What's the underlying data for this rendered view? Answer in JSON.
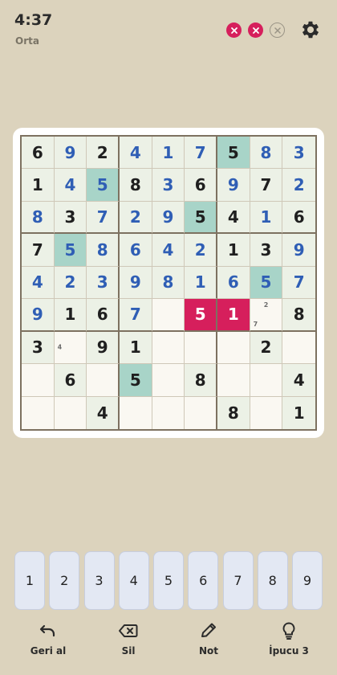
{
  "header": {
    "timer": "4:37",
    "difficulty": "Orta",
    "mistakes": [
      {
        "state": "on",
        "icon": "x-circle-icon"
      },
      {
        "state": "on",
        "icon": "x-circle-icon"
      },
      {
        "state": "off",
        "icon": "x-circle-icon"
      }
    ]
  },
  "colors": {
    "background": "#dcd3bd",
    "given_digit": "#1f1f1f",
    "user_digit": "#2f5eb5",
    "highlight": "#a8d4c8",
    "error": "#d61f5c",
    "filled_cell": "#ecf1e6"
  },
  "board": {
    "rows": [
      [
        {
          "v": "6",
          "t": "given"
        },
        {
          "v": "9",
          "t": "user"
        },
        {
          "v": "2",
          "t": "given"
        },
        {
          "v": "4",
          "t": "user"
        },
        {
          "v": "1",
          "t": "user"
        },
        {
          "v": "7",
          "t": "user"
        },
        {
          "v": "5",
          "t": "given",
          "h": true
        },
        {
          "v": "8",
          "t": "user"
        },
        {
          "v": "3",
          "t": "user"
        }
      ],
      [
        {
          "v": "1",
          "t": "given"
        },
        {
          "v": "4",
          "t": "user"
        },
        {
          "v": "5",
          "t": "user",
          "h": true
        },
        {
          "v": "8",
          "t": "given"
        },
        {
          "v": "3",
          "t": "user"
        },
        {
          "v": "6",
          "t": "given"
        },
        {
          "v": "9",
          "t": "user"
        },
        {
          "v": "7",
          "t": "given"
        },
        {
          "v": "2",
          "t": "user"
        }
      ],
      [
        {
          "v": "8",
          "t": "user"
        },
        {
          "v": "3",
          "t": "given"
        },
        {
          "v": "7",
          "t": "user"
        },
        {
          "v": "2",
          "t": "user"
        },
        {
          "v": "9",
          "t": "user"
        },
        {
          "v": "5",
          "t": "given",
          "h": true
        },
        {
          "v": "4",
          "t": "given"
        },
        {
          "v": "1",
          "t": "user"
        },
        {
          "v": "6",
          "t": "given"
        }
      ],
      [
        {
          "v": "7",
          "t": "given"
        },
        {
          "v": "5",
          "t": "user",
          "h": true
        },
        {
          "v": "8",
          "t": "user"
        },
        {
          "v": "6",
          "t": "user"
        },
        {
          "v": "4",
          "t": "user"
        },
        {
          "v": "2",
          "t": "user"
        },
        {
          "v": "1",
          "t": "given"
        },
        {
          "v": "3",
          "t": "given"
        },
        {
          "v": "9",
          "t": "user"
        }
      ],
      [
        {
          "v": "4",
          "t": "user"
        },
        {
          "v": "2",
          "t": "user"
        },
        {
          "v": "3",
          "t": "user"
        },
        {
          "v": "9",
          "t": "user"
        },
        {
          "v": "8",
          "t": "user"
        },
        {
          "v": "1",
          "t": "user"
        },
        {
          "v": "6",
          "t": "user"
        },
        {
          "v": "5",
          "t": "user",
          "h": true
        },
        {
          "v": "7",
          "t": "user"
        }
      ],
      [
        {
          "v": "9",
          "t": "user"
        },
        {
          "v": "1",
          "t": "given"
        },
        {
          "v": "6",
          "t": "given"
        },
        {
          "v": "7",
          "t": "user"
        },
        {
          "v": "",
          "t": "empty"
        },
        {
          "v": "5",
          "t": "error"
        },
        {
          "v": "1",
          "t": "error"
        },
        {
          "v": "",
          "t": "empty",
          "notes": [
            {
              "n": "2",
              "pos": "top"
            },
            {
              "n": "7",
              "pos": "bottom-left"
            }
          ]
        },
        {
          "v": "8",
          "t": "given"
        }
      ],
      [
        {
          "v": "3",
          "t": "given"
        },
        {
          "v": "",
          "t": "empty",
          "notes": [
            {
              "n": "4",
              "pos": "mid-left"
            }
          ]
        },
        {
          "v": "9",
          "t": "given"
        },
        {
          "v": "1",
          "t": "given"
        },
        {
          "v": "",
          "t": "empty"
        },
        {
          "v": "",
          "t": "empty"
        },
        {
          "v": "",
          "t": "empty"
        },
        {
          "v": "2",
          "t": "given"
        },
        {
          "v": "",
          "t": "empty"
        }
      ],
      [
        {
          "v": "",
          "t": "empty"
        },
        {
          "v": "6",
          "t": "given"
        },
        {
          "v": "",
          "t": "empty"
        },
        {
          "v": "5",
          "t": "given",
          "h": true
        },
        {
          "v": "",
          "t": "empty"
        },
        {
          "v": "8",
          "t": "given"
        },
        {
          "v": "",
          "t": "empty"
        },
        {
          "v": "",
          "t": "empty"
        },
        {
          "v": "4",
          "t": "given"
        }
      ],
      [
        {
          "v": "",
          "t": "empty"
        },
        {
          "v": "",
          "t": "empty"
        },
        {
          "v": "4",
          "t": "given"
        },
        {
          "v": "",
          "t": "empty"
        },
        {
          "v": "",
          "t": "empty"
        },
        {
          "v": "",
          "t": "empty"
        },
        {
          "v": "8",
          "t": "given"
        },
        {
          "v": "",
          "t": "empty"
        },
        {
          "v": "1",
          "t": "given"
        }
      ]
    ]
  },
  "numpad": [
    "1",
    "2",
    "3",
    "4",
    "5",
    "6",
    "7",
    "8",
    "9"
  ],
  "toolbar": {
    "undo_label": "Geri al",
    "erase_label": "Sil",
    "note_label": "Not",
    "hint_label": "İpucu 3"
  }
}
